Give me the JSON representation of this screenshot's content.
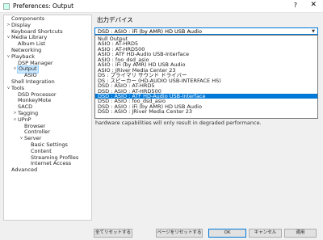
{
  "window": {
    "title": "Preferences: Output",
    "help_glyph": "?",
    "close_glyph": "✕"
  },
  "tree": {
    "items": [
      {
        "label": "Components",
        "level": 0,
        "expander": ""
      },
      {
        "label": "Display",
        "level": 0,
        "expander": ">"
      },
      {
        "label": "Keyboard Shortcuts",
        "level": 0,
        "expander": ""
      },
      {
        "label": "Media Library",
        "level": 0,
        "expander": "v"
      },
      {
        "label": "Album List",
        "level": 1,
        "expander": ""
      },
      {
        "label": "Networking",
        "level": 0,
        "expander": ""
      },
      {
        "label": "Playback",
        "level": 0,
        "expander": "v"
      },
      {
        "label": "DSP Manager",
        "level": 1,
        "expander": ""
      },
      {
        "label": "Output",
        "level": 1,
        "expander": "v",
        "selected": true
      },
      {
        "label": "ASIO",
        "level": 2,
        "expander": ""
      },
      {
        "label": "Shell Integration",
        "level": 0,
        "expander": ""
      },
      {
        "label": "Tools",
        "level": 0,
        "expander": "v"
      },
      {
        "label": "DSD Processor",
        "level": 1,
        "expander": ""
      },
      {
        "label": "MonkeyMote",
        "level": 1,
        "expander": ""
      },
      {
        "label": "SACD",
        "level": 1,
        "expander": ""
      },
      {
        "label": "Tagging",
        "level": 1,
        "expander": ">"
      },
      {
        "label": "UPnP",
        "level": 1,
        "expander": "v"
      },
      {
        "label": "Browser",
        "level": 2,
        "expander": ""
      },
      {
        "label": "Controller",
        "level": 2,
        "expander": ""
      },
      {
        "label": "Server",
        "level": 2,
        "expander": "v"
      },
      {
        "label": "Basic Settings",
        "level": 3,
        "expander": ""
      },
      {
        "label": "Content",
        "level": 3,
        "expander": ""
      },
      {
        "label": "Streaming Profiles",
        "level": 3,
        "expander": ""
      },
      {
        "label": "Internet Access",
        "level": 3,
        "expander": ""
      },
      {
        "label": "Advanced",
        "level": 0,
        "expander": ""
      }
    ]
  },
  "output": {
    "section_title": "出力デバイス",
    "current_value": "DSD : ASIO : iFi (by AMR) HD USB Audio",
    "dropdown_arrow": "▼",
    "options": [
      {
        "label": "Null Output",
        "selected": false
      },
      {
        "label": "ASIO : AT-HRD5",
        "selected": false
      },
      {
        "label": "ASIO : AT-HRD500",
        "selected": false
      },
      {
        "label": "ASIO : ATF HD-Audio USB-Interface",
        "selected": false
      },
      {
        "label": "ASIO : foo_dsd_asio",
        "selected": false
      },
      {
        "label": "ASIO : iFi (by AMR) HD USB Audio",
        "selected": false
      },
      {
        "label": "ASIO : JRiver Media Center 23",
        "selected": false
      },
      {
        "label": "DS : プライマリ サウンド ドライバー",
        "selected": false
      },
      {
        "label": "DS : スピーカー (HD-AUDIO USB-INTERFACE HS)",
        "selected": false
      },
      {
        "label": "DSD : ASIO : AT-HRD5",
        "selected": false
      },
      {
        "label": "DSD : ASIO : AT-HRD500",
        "selected": false
      },
      {
        "label": "DSD : ASIO : ATF HD-Audio USB-Interface",
        "selected": true
      },
      {
        "label": "DSD : ASIO : foo_dsd_asio",
        "selected": false
      },
      {
        "label": "DSD : ASIO : iFi (by AMR) HD USB Audio",
        "selected": false
      },
      {
        "label": "DSD : ASIO : JRiver Media Center 23",
        "selected": false
      }
    ],
    "hw_note": "hardware capabilities will only result in degraded performance."
  },
  "buttons": {
    "reset_all": "全てリセットする",
    "reset_page": "ページをリセットする",
    "ok": "OK",
    "cancel": "キャンセル",
    "apply": "適用"
  },
  "colors": {
    "selection": "#0078d7",
    "tree_selection": "#cce8ff"
  }
}
